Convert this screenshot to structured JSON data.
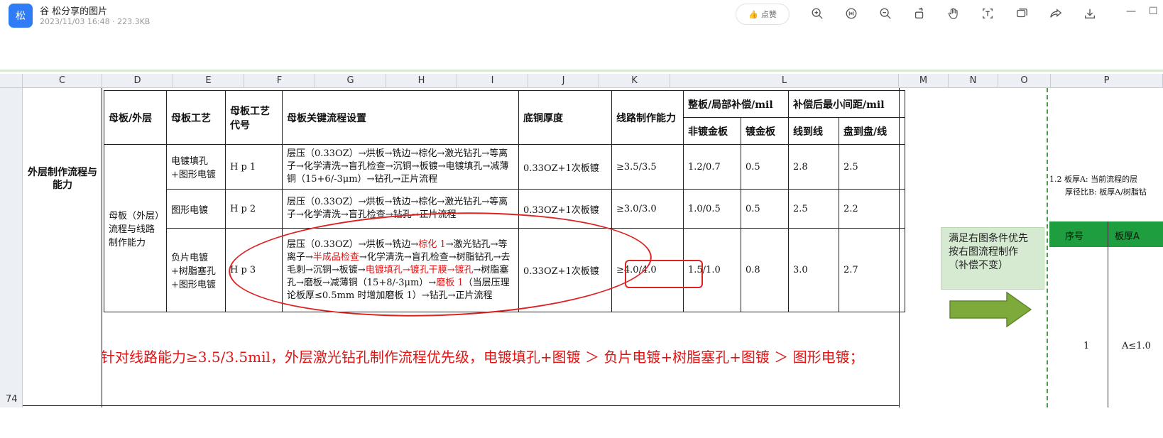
{
  "titlebar": {
    "app_icon_text": "松",
    "title": "谷 松分享的图片",
    "meta": "2023/11/03 16:48 · 223.3KB",
    "like_label": "点赞",
    "tools": [
      "zoom-in-icon",
      "fit-icon",
      "zoom-out-icon",
      "rotate-icon",
      "hand-icon",
      "text-extract-icon",
      "layers-icon",
      "share-icon",
      "download-icon"
    ],
    "window_min": "—",
    "window_max": "☐"
  },
  "sheet": {
    "columns": [
      "C",
      "D",
      "E",
      "F",
      "G",
      "H",
      "I",
      "J",
      "K",
      "L",
      "M",
      "N",
      "O",
      "P"
    ],
    "row_number": "74",
    "left_label": "外层制作流程与能力"
  },
  "table": {
    "headers": {
      "mother_board": "母板/外层",
      "process": "母板工艺",
      "process_code": "母板工艺代号",
      "key_flow": "母板关键流程设置",
      "base_copper": "底铜厚度",
      "line_capability": "线路制作能力",
      "compensation": "整板/局部补偿/mil",
      "min_spacing": "补偿后最小间距/mil",
      "non_gold": "非镀金板",
      "gold": "镀金板",
      "line_to_line": "线到线",
      "pad_to_pad": "盘到盘/线"
    },
    "group_label": "母板（外层）流程与线路制作能力",
    "rows": [
      {
        "process": "电镀填孔+图形电镀",
        "code": "H p 1",
        "flow": "层压（0.33OZ）→烘板→铣边→棕化→激光钻孔→等离子→化学清洗→盲孔检查→沉铜→板镀→电镀填孔→减薄铜（15+6/-3μm）→钻孔→正片流程",
        "copper": "0.33OZ+1次板镀",
        "capability": "≥3.5/3.5",
        "non_gold": "1.2/0.7",
        "gold": "0.5",
        "ltl": "2.8",
        "ptp": "2.5"
      },
      {
        "process": "图形电镀",
        "code": "H p 2",
        "flow": "层压（0.33OZ）→烘板→铣边→棕化→激光钻孔→等离子→化学清洗→盲孔检查→钻孔→正片流程",
        "copper": "0.33OZ+1次板镀",
        "capability": "≥3.0/3.0",
        "non_gold": "1.0/0.5",
        "gold": "0.5",
        "ltl": "2.5",
        "ptp": "2.2"
      },
      {
        "process": "负片电镀+树脂塞孔+图形电镀",
        "code": "H p 3",
        "flow_parts": [
          {
            "t": "层压（0.33OZ）→烘板→铣边→",
            "red": false
          },
          {
            "t": "棕化 1",
            "red": true
          },
          {
            "t": "→激光钻孔→等离子→",
            "red": false
          },
          {
            "t": "半成品检查",
            "red": true
          },
          {
            "t": "→化学清洗→盲孔检查→树脂钻孔→去毛刺→沉铜→板镀→",
            "red": false
          },
          {
            "t": "电镀填孔→镀孔干膜→镀孔",
            "red": true
          },
          {
            "t": "→树脂塞孔→磨板→减薄铜（15+8/-3μm）→",
            "red": false
          },
          {
            "t": "磨板 1",
            "red": true
          },
          {
            "t": "（当层压理论板厚≤0.5mm 时增加磨板 1）→钻孔→正片流程",
            "red": false
          }
        ],
        "copper": "0.33OZ+1次板镀",
        "capability": "≥4.0/4.0",
        "non_gold": "1.5/1.0",
        "gold": "0.8",
        "ltl": "3.0",
        "ptp": "2.7"
      }
    ]
  },
  "note": "针对线路能力≥3.5/3.5mil，外层激光钻孔制作流程优先级，电镀填孔+图镀 ＞ 负片电镀+树脂塞孔+图镀 ＞ 图形电镀；",
  "callout": "满足右图条件优先按右图流程制作（补偿不变）",
  "right_pane": {
    "line1": "1.2 板厚A:  当前流程的层",
    "line2": "厚径比B: 板厚A/树脂钻",
    "header1": "序号",
    "header2": "板厚A",
    "value1": "1",
    "value2": "A≤1.0"
  },
  "colors": {
    "accent": "#2f7cf6",
    "red": "#e01414",
    "callout_bg": "#d5ead0",
    "arrow": "#7eaa3c",
    "header_green": "#1e9e3e"
  }
}
